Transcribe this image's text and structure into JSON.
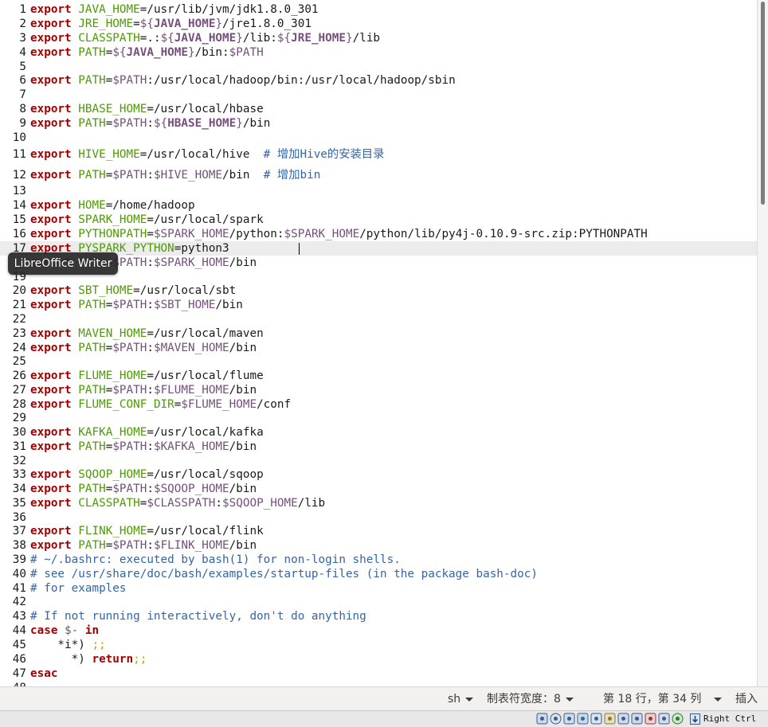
{
  "tooltip": "LibreOffice Writer",
  "editor": {
    "current_line_index": 16,
    "caret_after_chars": 39,
    "lines": [
      {
        "n": "1",
        "tokens": [
          [
            "kw",
            "export"
          ],
          [
            "txt",
            " "
          ],
          [
            "var",
            "JAVA_HOME"
          ],
          [
            "op",
            "="
          ],
          [
            "txt",
            "/usr/lib/jvm/jdk1.8.0_301"
          ]
        ]
      },
      {
        "n": "2",
        "tokens": [
          [
            "kw",
            "export"
          ],
          [
            "txt",
            " "
          ],
          [
            "var",
            "JRE_HOME"
          ],
          [
            "op",
            "="
          ],
          [
            "ref",
            "${"
          ],
          [
            "refb",
            "JAVA_HOME"
          ],
          [
            "ref",
            "}"
          ],
          [
            "txt",
            "/jre1.8.0_301"
          ]
        ]
      },
      {
        "n": "3",
        "tokens": [
          [
            "kw",
            "export"
          ],
          [
            "txt",
            " "
          ],
          [
            "var",
            "CLASSPATH"
          ],
          [
            "op",
            "="
          ],
          [
            "txt",
            ".:"
          ],
          [
            "ref",
            "${"
          ],
          [
            "refb",
            "JAVA_HOME"
          ],
          [
            "ref",
            "}"
          ],
          [
            "txt",
            "/lib:"
          ],
          [
            "ref",
            "${"
          ],
          [
            "refb",
            "JRE_HOME"
          ],
          [
            "ref",
            "}"
          ],
          [
            "txt",
            "/lib"
          ]
        ]
      },
      {
        "n": "4",
        "tokens": [
          [
            "kw",
            "export"
          ],
          [
            "txt",
            " "
          ],
          [
            "var",
            "PATH"
          ],
          [
            "op",
            "="
          ],
          [
            "ref",
            "${"
          ],
          [
            "refb",
            "JAVA_HOME"
          ],
          [
            "ref",
            "}"
          ],
          [
            "txt",
            "/bin:"
          ],
          [
            "ref",
            "$PATH"
          ]
        ]
      },
      {
        "n": "5",
        "tokens": []
      },
      {
        "n": "6",
        "tokens": [
          [
            "kw",
            "export"
          ],
          [
            "txt",
            " "
          ],
          [
            "var",
            "PATH"
          ],
          [
            "op",
            "="
          ],
          [
            "ref",
            "$PATH"
          ],
          [
            "txt",
            ":/usr/local/hadoop/bin:/usr/local/hadoop/sbin"
          ]
        ]
      },
      {
        "n": "7",
        "tokens": []
      },
      {
        "n": "8",
        "tokens": [
          [
            "kw",
            "export"
          ],
          [
            "txt",
            " "
          ],
          [
            "var",
            "HBASE_HOME"
          ],
          [
            "op",
            "="
          ],
          [
            "txt",
            "/usr/local/hbase"
          ]
        ]
      },
      {
        "n": "9",
        "tokens": [
          [
            "kw",
            "export"
          ],
          [
            "txt",
            " "
          ],
          [
            "var",
            "PATH"
          ],
          [
            "op",
            "="
          ],
          [
            "ref",
            "$PATH"
          ],
          [
            "txt",
            ":"
          ],
          [
            "ref",
            "${"
          ],
          [
            "refb",
            "HBASE_HOME"
          ],
          [
            "ref",
            "}"
          ],
          [
            "txt",
            "/bin"
          ]
        ]
      },
      {
        "n": "10",
        "tokens": []
      },
      {
        "n": "11",
        "tokens": [
          [
            "kw",
            "export"
          ],
          [
            "txt",
            " "
          ],
          [
            "var",
            "HIVE_HOME"
          ],
          [
            "op",
            "="
          ],
          [
            "txt",
            "/usr/local/hive  "
          ],
          [
            "cmt",
            "# 增加Hive的安装目录"
          ]
        ]
      },
      {
        "n": "12",
        "tokens": [
          [
            "kw",
            "export"
          ],
          [
            "txt",
            " "
          ],
          [
            "var",
            "PATH"
          ],
          [
            "op",
            "="
          ],
          [
            "ref",
            "$PATH"
          ],
          [
            "txt",
            ":"
          ],
          [
            "ref",
            "$HIVE_HOME"
          ],
          [
            "txt",
            "/bin  "
          ],
          [
            "cmt",
            "# 增加bin"
          ]
        ]
      },
      {
        "n": "13",
        "tokens": []
      },
      {
        "n": "14",
        "tokens": [
          [
            "kw",
            "export"
          ],
          [
            "txt",
            " "
          ],
          [
            "var",
            "HOME"
          ],
          [
            "op",
            "="
          ],
          [
            "txt",
            "/home/hadoop"
          ]
        ]
      },
      {
        "n": "15",
        "tokens": [
          [
            "kw",
            "export"
          ],
          [
            "txt",
            " "
          ],
          [
            "var",
            "SPARK_HOME"
          ],
          [
            "op",
            "="
          ],
          [
            "txt",
            "/usr/local/spark"
          ]
        ]
      },
      {
        "n": "16",
        "tokens": [
          [
            "kw",
            "export"
          ],
          [
            "txt",
            " "
          ],
          [
            "var",
            "PYTHONPATH"
          ],
          [
            "op",
            "="
          ],
          [
            "ref",
            "$SPARK_HOME"
          ],
          [
            "txt",
            "/python:"
          ],
          [
            "ref",
            "$SPARK_HOME"
          ],
          [
            "txt",
            "/python/lib/py4j-0.10.9-src.zip:PYTHONPATH"
          ]
        ]
      },
      {
        "n": "17",
        "tokens": [
          [
            "kw",
            "export"
          ],
          [
            "txt",
            " "
          ],
          [
            "var",
            "PYSPARK_PYTHON"
          ],
          [
            "op",
            "="
          ],
          [
            "txt",
            "python3"
          ]
        ]
      },
      {
        "n": "18",
        "tokens": [
          [
            "kw",
            "export"
          ],
          [
            "txt",
            " "
          ],
          [
            "var",
            "PATH"
          ],
          [
            "op",
            "="
          ],
          [
            "ref",
            "$PATH"
          ],
          [
            "txt",
            ":"
          ],
          [
            "ref",
            "$SPARK_HOME"
          ],
          [
            "txt",
            "/bin"
          ]
        ]
      },
      {
        "n": "19",
        "tokens": []
      },
      {
        "n": "20",
        "tokens": [
          [
            "kw",
            "export"
          ],
          [
            "txt",
            " "
          ],
          [
            "var",
            "SBT_HOME"
          ],
          [
            "op",
            "="
          ],
          [
            "txt",
            "/usr/local/sbt"
          ]
        ]
      },
      {
        "n": "21",
        "tokens": [
          [
            "kw",
            "export"
          ],
          [
            "txt",
            " "
          ],
          [
            "var",
            "PATH"
          ],
          [
            "op",
            "="
          ],
          [
            "ref",
            "$PATH"
          ],
          [
            "txt",
            ":"
          ],
          [
            "ref",
            "$SBT_HOME"
          ],
          [
            "txt",
            "/bin"
          ]
        ]
      },
      {
        "n": "22",
        "tokens": []
      },
      {
        "n": "23",
        "tokens": [
          [
            "kw",
            "export"
          ],
          [
            "txt",
            " "
          ],
          [
            "var",
            "MAVEN_HOME"
          ],
          [
            "op",
            "="
          ],
          [
            "txt",
            "/usr/local/maven"
          ]
        ]
      },
      {
        "n": "24",
        "tokens": [
          [
            "kw",
            "export"
          ],
          [
            "txt",
            " "
          ],
          [
            "var",
            "PATH"
          ],
          [
            "op",
            "="
          ],
          [
            "ref",
            "$PATH"
          ],
          [
            "txt",
            ":"
          ],
          [
            "ref",
            "$MAVEN_HOME"
          ],
          [
            "txt",
            "/bin"
          ]
        ]
      },
      {
        "n": "25",
        "tokens": []
      },
      {
        "n": "26",
        "tokens": [
          [
            "kw",
            "export"
          ],
          [
            "txt",
            " "
          ],
          [
            "var",
            "FLUME_HOME"
          ],
          [
            "op",
            "="
          ],
          [
            "txt",
            "/usr/local/flume"
          ]
        ]
      },
      {
        "n": "27",
        "tokens": [
          [
            "kw",
            "export"
          ],
          [
            "txt",
            " "
          ],
          [
            "var",
            "PATH"
          ],
          [
            "op",
            "="
          ],
          [
            "ref",
            "$PATH"
          ],
          [
            "txt",
            ":"
          ],
          [
            "ref",
            "$FLUME_HOME"
          ],
          [
            "txt",
            "/bin"
          ]
        ]
      },
      {
        "n": "28",
        "tokens": [
          [
            "kw",
            "export"
          ],
          [
            "txt",
            " "
          ],
          [
            "var",
            "FLUME_CONF_DIR"
          ],
          [
            "op",
            "="
          ],
          [
            "ref",
            "$FLUME_HOME"
          ],
          [
            "txt",
            "/conf"
          ]
        ]
      },
      {
        "n": "29",
        "tokens": []
      },
      {
        "n": "30",
        "tokens": [
          [
            "kw",
            "export"
          ],
          [
            "txt",
            " "
          ],
          [
            "var",
            "KAFKA_HOME"
          ],
          [
            "op",
            "="
          ],
          [
            "txt",
            "/usr/local/kafka"
          ]
        ]
      },
      {
        "n": "31",
        "tokens": [
          [
            "kw",
            "export"
          ],
          [
            "txt",
            " "
          ],
          [
            "var",
            "PATH"
          ],
          [
            "op",
            "="
          ],
          [
            "ref",
            "$PATH"
          ],
          [
            "txt",
            ":"
          ],
          [
            "ref",
            "$KAFKA_HOME"
          ],
          [
            "txt",
            "/bin"
          ]
        ]
      },
      {
        "n": "32",
        "tokens": []
      },
      {
        "n": "33",
        "tokens": [
          [
            "kw",
            "export"
          ],
          [
            "txt",
            " "
          ],
          [
            "var",
            "SQOOP_HOME"
          ],
          [
            "op",
            "="
          ],
          [
            "txt",
            "/usr/local/sqoop"
          ]
        ]
      },
      {
        "n": "34",
        "tokens": [
          [
            "kw",
            "export"
          ],
          [
            "txt",
            " "
          ],
          [
            "var",
            "PATH"
          ],
          [
            "op",
            "="
          ],
          [
            "ref",
            "$PATH"
          ],
          [
            "txt",
            ":"
          ],
          [
            "ref",
            "$SQOOP_HOME"
          ],
          [
            "txt",
            "/bin"
          ]
        ]
      },
      {
        "n": "35",
        "tokens": [
          [
            "kw",
            "export"
          ],
          [
            "txt",
            " "
          ],
          [
            "var",
            "CLASSPATH"
          ],
          [
            "op",
            "="
          ],
          [
            "ref",
            "$CLASSPATH"
          ],
          [
            "txt",
            ":"
          ],
          [
            "ref",
            "$SQOOP_HOME"
          ],
          [
            "txt",
            "/lib"
          ]
        ]
      },
      {
        "n": "36",
        "tokens": []
      },
      {
        "n": "37",
        "tokens": [
          [
            "kw",
            "export"
          ],
          [
            "txt",
            " "
          ],
          [
            "var",
            "FLINK_HOME"
          ],
          [
            "op",
            "="
          ],
          [
            "txt",
            "/usr/local/flink"
          ]
        ]
      },
      {
        "n": "38",
        "tokens": [
          [
            "kw",
            "export"
          ],
          [
            "txt",
            " "
          ],
          [
            "var",
            "PATH"
          ],
          [
            "op",
            "="
          ],
          [
            "ref",
            "$PATH"
          ],
          [
            "txt",
            ":"
          ],
          [
            "ref",
            "$FLINK_HOME"
          ],
          [
            "txt",
            "/bin"
          ]
        ]
      },
      {
        "n": "39",
        "tokens": [
          [
            "cmt",
            "# ~/.bashrc: executed by bash(1) for non-login shells."
          ]
        ]
      },
      {
        "n": "40",
        "tokens": [
          [
            "cmt",
            "# see /usr/share/doc/bash/examples/startup-files (in the package bash-doc)"
          ]
        ]
      },
      {
        "n": "41",
        "tokens": [
          [
            "cmt",
            "# for examples"
          ]
        ]
      },
      {
        "n": "42",
        "tokens": []
      },
      {
        "n": "43",
        "tokens": [
          [
            "cmt",
            "# If not running interactively, don't do anything"
          ]
        ]
      },
      {
        "n": "44",
        "tokens": [
          [
            "kw",
            "case"
          ],
          [
            "txt",
            " "
          ],
          [
            "ref",
            "$-"
          ],
          [
            "txt",
            " "
          ],
          [
            "kw",
            "in"
          ]
        ]
      },
      {
        "n": "45",
        "tokens": [
          [
            "txt",
            "    *i*) "
          ],
          [
            "pun",
            ";;"
          ]
        ]
      },
      {
        "n": "46",
        "tokens": [
          [
            "txt",
            "      *) "
          ],
          [
            "kw",
            "return"
          ],
          [
            "pun",
            ";;"
          ]
        ]
      },
      {
        "n": "47",
        "tokens": [
          [
            "kw",
            "esac"
          ]
        ]
      },
      {
        "n": "48",
        "tokens": []
      }
    ]
  },
  "statusbar": {
    "language": "sh",
    "tab_width": "制表符宽度：8",
    "position": "第 18 行，第 34 列",
    "mode": "插入"
  },
  "vbox": {
    "host_key": "Right Ctrl",
    "icons": [
      "hard-disk-icon",
      "optical-drive-icon",
      "audio-icon",
      "network-icon",
      "usb-icon",
      "shared-folder-icon",
      "display-icon",
      "video-capture-icon",
      "recording-icon",
      "cpu-icon",
      "mouse-integration-icon"
    ]
  }
}
